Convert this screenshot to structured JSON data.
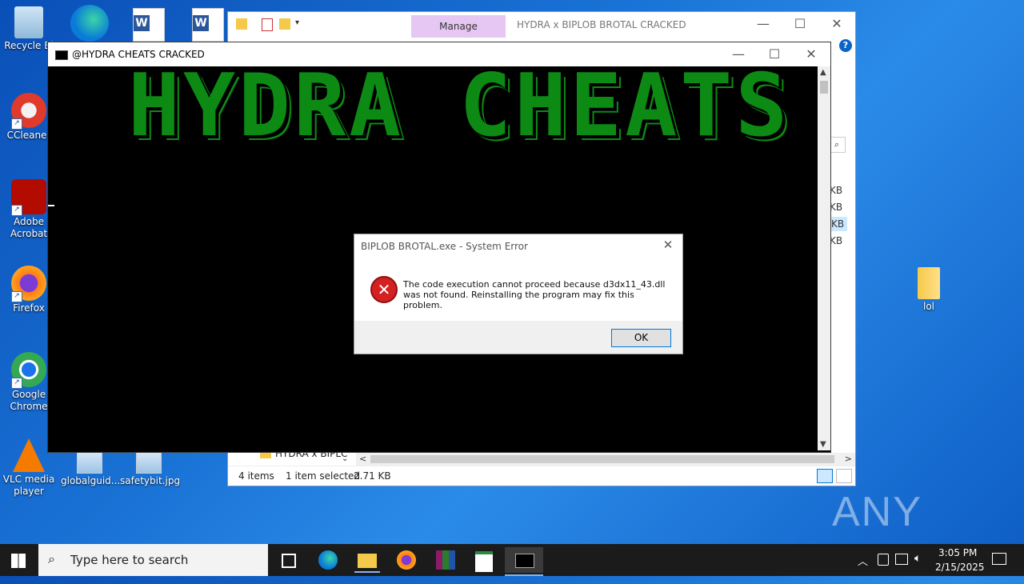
{
  "desktop": {
    "icons": [
      {
        "label": "Recycle Bi",
        "icon": "recycle-bin-icon"
      },
      {
        "label": "CCleaner",
        "icon": "ccleaner-icon"
      },
      {
        "label": "Adobe Acrobat",
        "icon": "acrobat-icon"
      },
      {
        "label": "Firefox",
        "icon": "firefox-icon"
      },
      {
        "label": "Google Chrome",
        "icon": "chrome-icon"
      },
      {
        "label": "VLC media player",
        "icon": "vlc-icon"
      },
      {
        "label": "globalguid...",
        "icon": "image-file-icon"
      },
      {
        "label": "safetybit.jpg",
        "icon": "image-file-icon"
      },
      {
        "label": "lol",
        "icon": "folder-icon"
      }
    ]
  },
  "explorer": {
    "manage_tab": "Manage",
    "title": "HYDRA x BIPLOB BROTAL CRACKED",
    "size_col": [
      "KB",
      "KB",
      "KB",
      "KB"
    ],
    "folder_item": "HYDRA x BIPLC",
    "status": {
      "items": "4 items",
      "selected": "1 item selected",
      "size": "2.71 KB"
    }
  },
  "cmd": {
    "title": "@HYDRA CHEATS CRACKED",
    "banner": "HYDRA CHEATS"
  },
  "dialog": {
    "title": "BIPLOB BROTAL.exe - System Error",
    "message_line1": "The code execution cannot proceed because d3dx11_43.dll",
    "message_line2": "was not found. Reinstalling the program may fix this problem.",
    "ok_label": "OK"
  },
  "taskbar": {
    "search_placeholder": "Type here to search",
    "time": "3:05 PM",
    "date": "2/15/2025"
  },
  "watermark": "ANY RUN",
  "colors": {
    "banner_green": "#0d8a14",
    "error_red": "#d42020",
    "accent": "#0078d7"
  }
}
